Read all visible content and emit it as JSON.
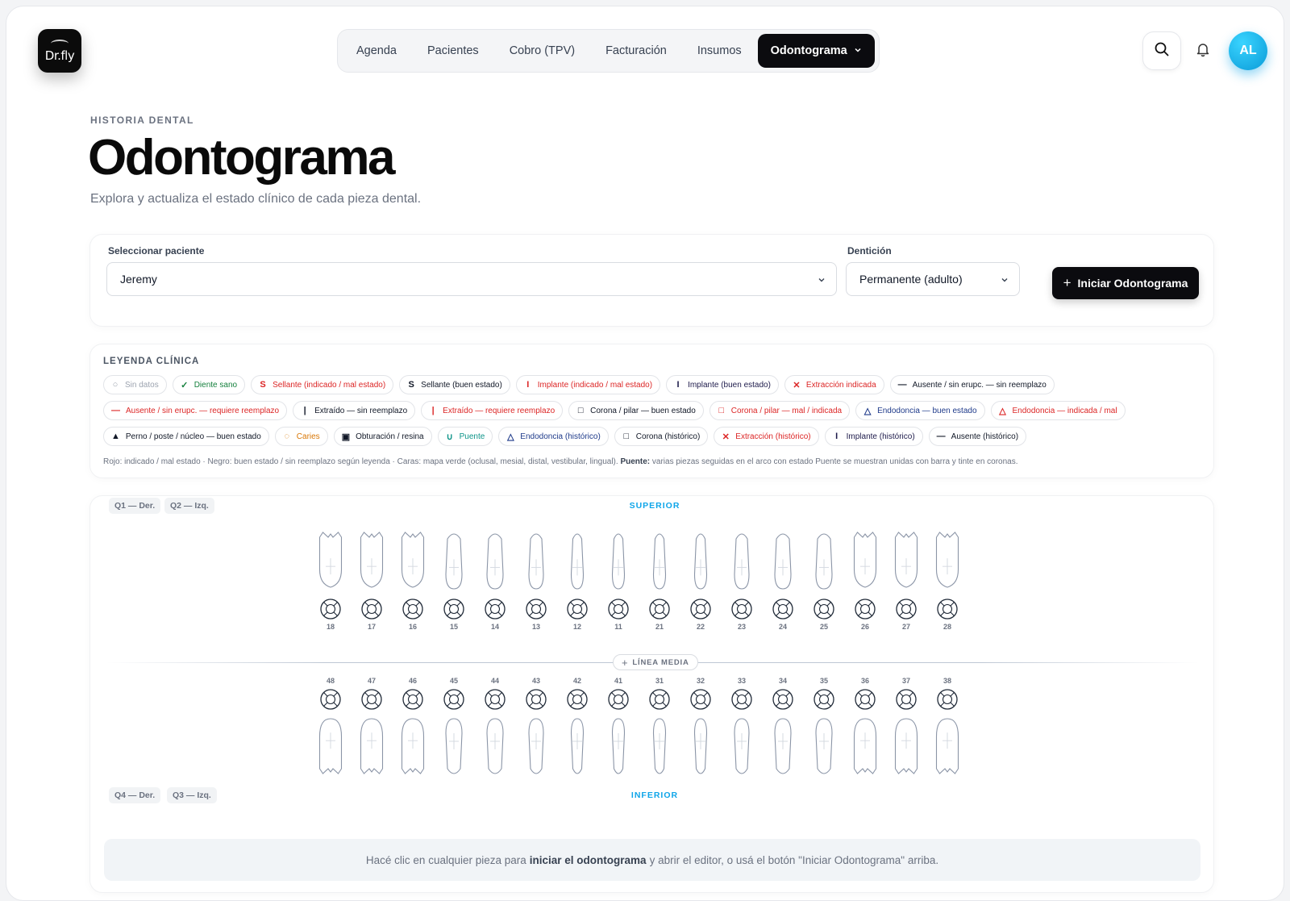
{
  "app": {
    "brand": "Dr.fly",
    "avatar_initials": "AL"
  },
  "nav": {
    "items": [
      "Agenda",
      "Pacientes",
      "Cobro (TPV)",
      "Facturación",
      "Insumos"
    ],
    "active": "Odontograma"
  },
  "header": {
    "eyebrow": "HISTORIA DENTAL",
    "title": "Odontograma",
    "subtitle": "Explora y actualiza el estado clínico de cada pieza dental."
  },
  "selector": {
    "patient_label": "Seleccionar paciente",
    "patient_value": "Jeremy",
    "dentition_label": "Dentición",
    "dentition_value": "Permanente (adulto)",
    "start_button": "Iniciar Odontograma"
  },
  "legend": {
    "title": "LEYENDA CLÍNICA",
    "items": [
      {
        "symbol": "○",
        "label": "Sin datos",
        "color": "#9ca3af"
      },
      {
        "symbol": "✓",
        "label": "Diente sano",
        "color": "#15803d"
      },
      {
        "symbol": "S",
        "label": "Sellante (indicado / mal estado)",
        "color": "#dc2626"
      },
      {
        "symbol": "S",
        "label": "Sellante (buen estado)",
        "color": "#111827"
      },
      {
        "symbol": "I",
        "label": "Implante (indicado / mal estado)",
        "color": "#dc2626"
      },
      {
        "symbol": "I",
        "label": "Implante (buen estado)",
        "color": "#1e1b4b"
      },
      {
        "symbol": "✕",
        "label": "Extracción indicada",
        "color": "#dc2626"
      },
      {
        "symbol": "—",
        "label": "Ausente / sin erupc. — sin reemplazo",
        "color": "#111827"
      },
      {
        "symbol": "—",
        "label": "Ausente / sin erupc. — requiere reemplazo",
        "color": "#dc2626"
      },
      {
        "symbol": "|",
        "label": "Extraído — sin reemplazo",
        "color": "#111827"
      },
      {
        "symbol": "|",
        "label": "Extraído — requiere reemplazo",
        "color": "#dc2626"
      },
      {
        "symbol": "□",
        "label": "Corona / pilar — buen estado",
        "color": "#111827"
      },
      {
        "symbol": "□",
        "label": "Corona / pilar — mal / indicada",
        "color": "#dc2626"
      },
      {
        "symbol": "△",
        "label": "Endodoncia — buen estado",
        "color": "#1e3a8a"
      },
      {
        "symbol": "△",
        "label": "Endodoncia — indicada / mal",
        "color": "#dc2626"
      },
      {
        "symbol": "▲",
        "label": "Perno / poste / núcleo — buen estado",
        "color": "#111827"
      },
      {
        "symbol": "◌",
        "label": "Caries",
        "color": "#d97706"
      },
      {
        "symbol": "▣",
        "label": "Obturación / resina",
        "color": "#111827"
      },
      {
        "symbol": "∪",
        "label": "Puente",
        "color": "#0d9488"
      },
      {
        "symbol": "△",
        "label": "Endodoncia (histórico)",
        "color": "#1e3a8a"
      },
      {
        "symbol": "□",
        "label": "Corona (histórico)",
        "color": "#111827"
      },
      {
        "symbol": "✕",
        "label": "Extracción (histórico)",
        "color": "#dc2626"
      },
      {
        "symbol": "I",
        "label": "Implante (histórico)",
        "color": "#1e1b4b"
      },
      {
        "symbol": "—",
        "label": "Ausente (histórico)",
        "color": "#111827"
      }
    ],
    "note_prefix": "Rojo: indicado / mal estado · Negro: buen estado / sin reemplazo según leyenda · Caras: mapa verde (oclusal, mesial, distal, vestibular, lingual). ",
    "note_bold": "Puente:",
    "note_suffix": " varias piezas seguidas en el arco con estado Puente se muestran unidas con barra y tinte en coronas."
  },
  "chart": {
    "q1": "Q1 — Der.",
    "q2": "Q2 — Izq.",
    "q4": "Q4 — Der.",
    "q3": "Q3 — Izq.",
    "upper_label": "SUPERIOR",
    "lower_label": "INFERIOR",
    "midline_label": "LÍNEA MEDIA",
    "upper_teeth": [
      "18",
      "17",
      "16",
      "15",
      "14",
      "13",
      "12",
      "11",
      "21",
      "22",
      "23",
      "24",
      "25",
      "26",
      "27",
      "28"
    ],
    "lower_teeth": [
      "48",
      "47",
      "46",
      "45",
      "44",
      "43",
      "42",
      "41",
      "31",
      "32",
      "33",
      "34",
      "35",
      "36",
      "37",
      "38"
    ],
    "hint_prefix": "Hacé clic en cualquier pieza para",
    "hint_bold": "iniciar el odontograma",
    "hint_suffix": "y abrir el editor, o usá el botón \"Iniciar Odontograma\" arriba."
  }
}
